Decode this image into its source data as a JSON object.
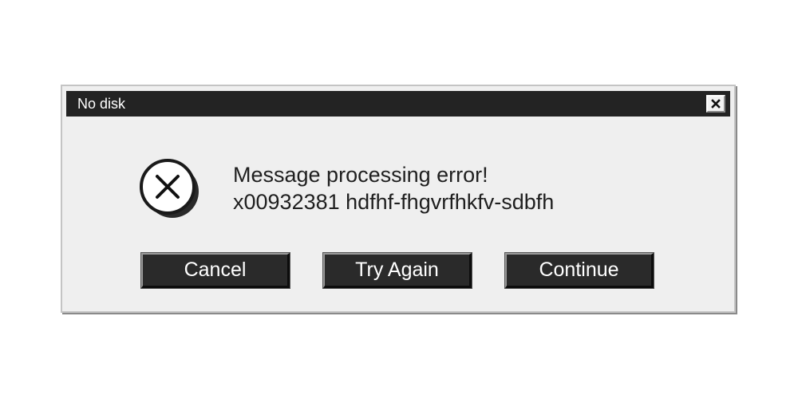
{
  "dialog": {
    "title": "No disk",
    "message_line1": "Message processing error!",
    "message_line2": "x00932381 hdfhf-fhgvrfhkfv-sdbfh",
    "icons": {
      "close": "close-icon",
      "error": "error-x-icon"
    },
    "buttons": {
      "cancel": "Cancel",
      "try_again": "Try Again",
      "continue": "Continue"
    }
  },
  "colors": {
    "titlebar": "#232323",
    "dialog_background": "#efefef",
    "button_background": "#2a2a2a",
    "text": "#1f1f1f"
  }
}
